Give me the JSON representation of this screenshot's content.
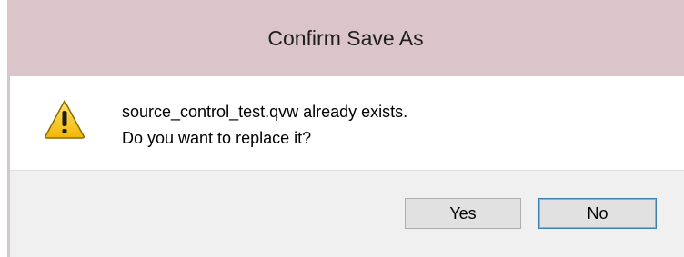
{
  "dialog": {
    "title": "Confirm Save As",
    "icon": "warning-icon",
    "message_line1": "source_control_test.qvw already exists.",
    "message_line2": "Do you want to replace it?",
    "buttons": {
      "yes_label": "Yes",
      "no_label": "No"
    },
    "colors": {
      "frame": "#dbc5cb",
      "warning_fill": "#f5c518",
      "default_button_border": "#3c7fb1"
    }
  }
}
